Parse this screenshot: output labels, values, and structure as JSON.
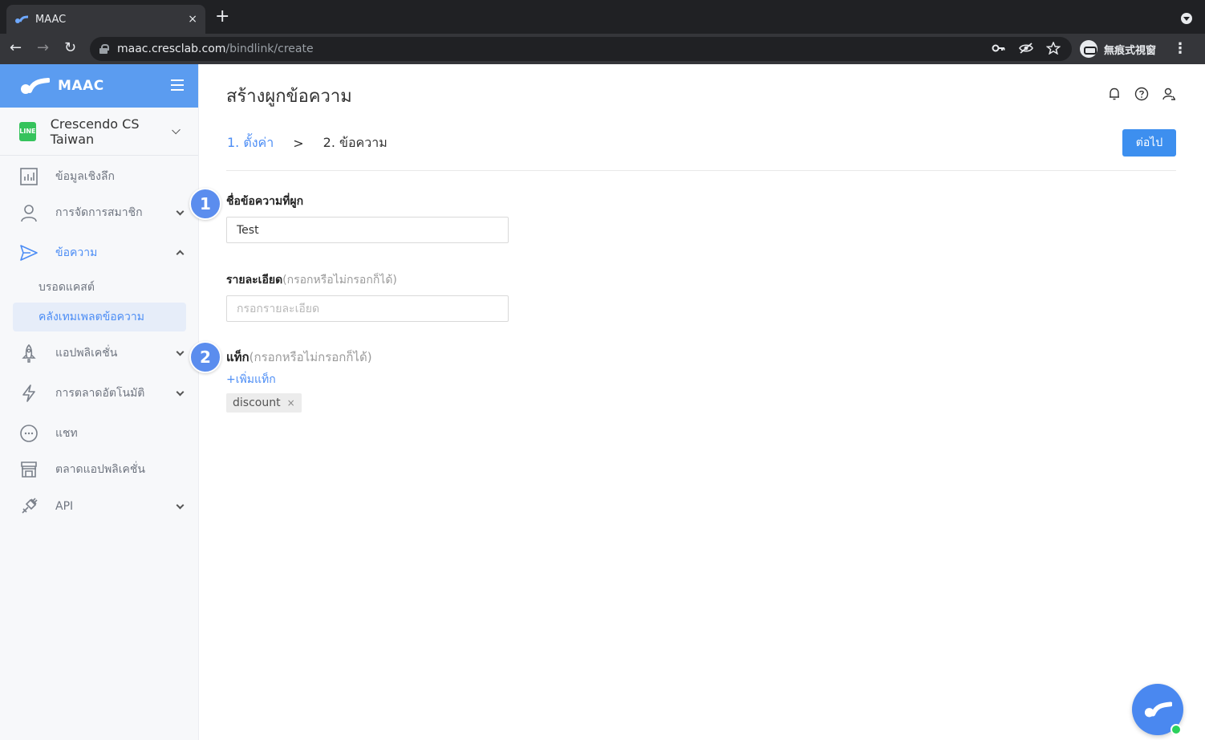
{
  "browser": {
    "tab_title": "MAAC",
    "tab_close": "×",
    "new_tab": "+",
    "url_host": "maac.cresclab.com",
    "url_path": "/bindlink/create",
    "profile_label": "無痕式視窗",
    "menu": "⋮"
  },
  "sidebar": {
    "brand": "MAAC",
    "account_badge": "LINE",
    "account_name": "Crescendo CS Taiwan",
    "items": [
      {
        "label": "ข้อมูลเชิงลึก",
        "icon": "insights-chart-icon"
      },
      {
        "label": "การจัดการสมาชิก",
        "icon": "member-icon"
      },
      {
        "label": "ข้อความ",
        "icon": "send-message-icon"
      },
      {
        "label": "แอปพลิเคชั่น",
        "icon": "rocket-icon"
      },
      {
        "label": "การตลาดอัตโนมัติ",
        "icon": "lightning-icon"
      },
      {
        "label": "แชท",
        "icon": "chat-bubble-icon"
      },
      {
        "label": "ตลาดแอปพลิเคชั่น",
        "icon": "store-icon"
      },
      {
        "label": "API",
        "icon": "plug-icon"
      }
    ],
    "subitems": [
      {
        "label": "บรอดแคสต์"
      },
      {
        "label": "คลังเทมเพลตข้อความ"
      }
    ]
  },
  "main": {
    "title": "สร้างผูกข้อความ",
    "step1": "1. ตั้งค่า",
    "step_separator": ">",
    "step2": "2. ข้อความ",
    "next_button": "ต่อไป",
    "name_label": "ชื่อข้อความที่ผูก",
    "name_value": "Test",
    "detail_label": "รายละเอียด",
    "detail_hint": "(กรอกหรือไม่กรอกก็ได้)",
    "detail_placeholder": "กรอกรายละเอียด",
    "tag_label": "แท็ก",
    "tag_hint": "(กรอกหรือไม่กรอกก็ได้)",
    "add_tag": "+เพิ่มแท็ก",
    "tags": [
      "discount"
    ],
    "tag_close": "×"
  },
  "markers": [
    "1",
    "2"
  ],
  "colors": {
    "brand_blue": "#5b9cf0",
    "accent_blue": "#4c8df5",
    "button_blue": "#3d8fef",
    "line_green": "#35c35c",
    "online_green": "#2bd15c"
  }
}
